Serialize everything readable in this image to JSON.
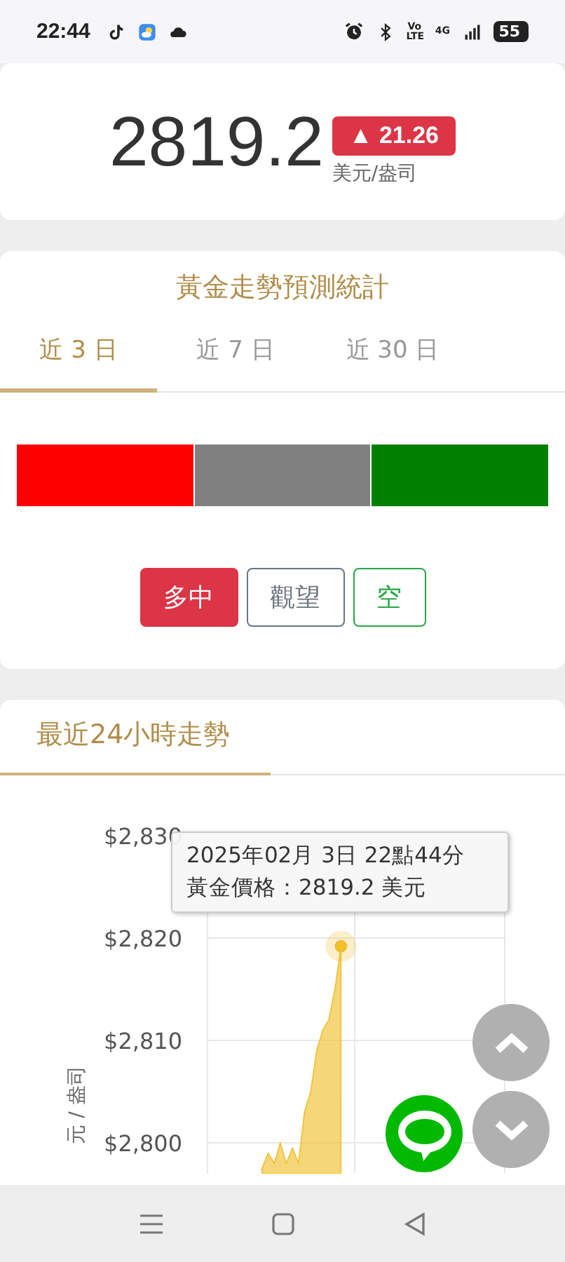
{
  "status_bar": {
    "time": "22:44",
    "volte": "Vo LTE",
    "network": "4G",
    "battery": "55"
  },
  "price": {
    "value": "2819.2",
    "change": "▲ 21.26",
    "unit": "美元/盎司"
  },
  "forecast": {
    "title": "黃金走勢預測統計",
    "tabs": [
      {
        "label": "近 3 日",
        "selected": true
      },
      {
        "label": "近 7 日",
        "selected": false
      },
      {
        "label": "近 30 日",
        "selected": false
      }
    ],
    "segments": [
      {
        "color": "#ff0000"
      },
      {
        "color": "#808080"
      },
      {
        "color": "#008000"
      }
    ],
    "signals": [
      {
        "label": "多中",
        "color": "#dc3545",
        "selected": true
      },
      {
        "label": "觀望",
        "color": "#6c757d",
        "selected": false
      },
      {
        "label": "空",
        "color": "#28a745",
        "selected": false
      }
    ]
  },
  "trend": {
    "title": "最近24小時走勢",
    "tooltip": {
      "line_1": "2025年02月 3日 22點44分",
      "line_2": "黃金價格：2819.2 美元"
    },
    "chart_data": {
      "type": "area",
      "ylabel": "元 / 盎司",
      "grid": true,
      "ylim": [
        2797,
        2830
      ],
      "yticks": [
        {
          "value": 2800,
          "label": "$2,800"
        },
        {
          "value": 2810,
          "label": "$2,810"
        },
        {
          "value": 2820,
          "label": "$2,820"
        },
        {
          "value": 2830,
          "label": "$2,830"
        }
      ],
      "series": [
        {
          "color": "#f0c030",
          "values": [
            null,
            null,
            null,
            null,
            null,
            null,
            null,
            null,
            null,
            2797.5,
            2799,
            2798,
            2800,
            2798,
            2799.5,
            2798,
            2803,
            2805,
            2809,
            2811,
            2812,
            2815,
            2819.2,
            null,
            null,
            null,
            null,
            null,
            null,
            null,
            null,
            null,
            null,
            null,
            null,
            null,
            null,
            null,
            null,
            null,
            null,
            null,
            null,
            null,
            null,
            null,
            null,
            null,
            null,
            null
          ]
        }
      ]
    }
  }
}
